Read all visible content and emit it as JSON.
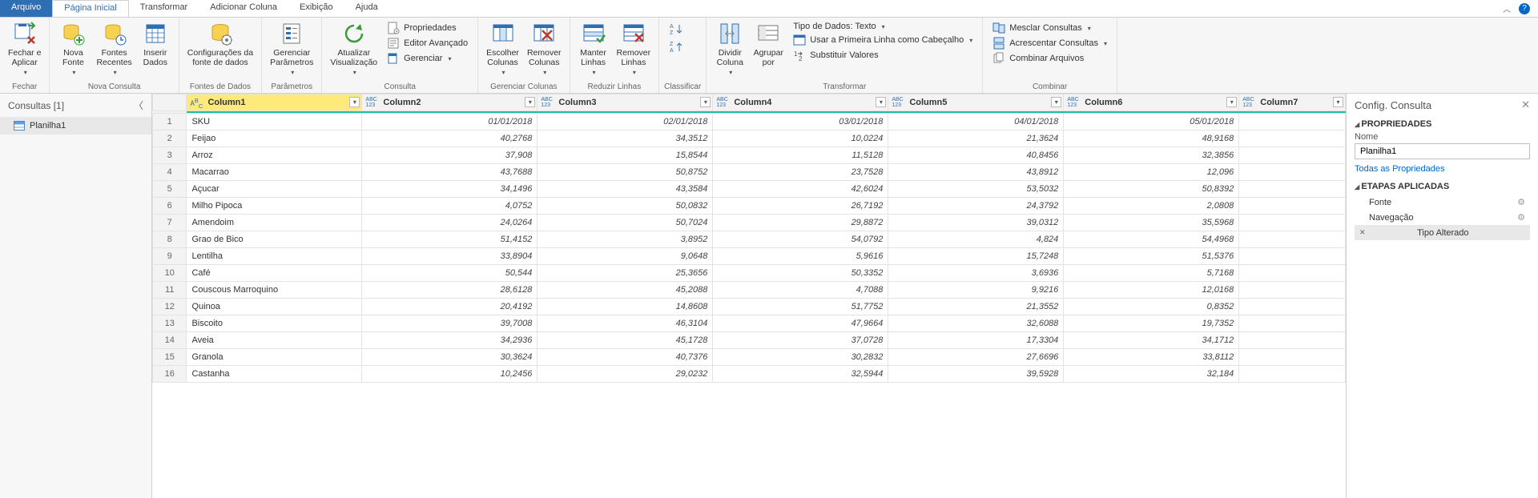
{
  "menubar": {
    "file": "Arquivo",
    "tabs": [
      "Página Inicial",
      "Transformar",
      "Adicionar Coluna",
      "Exibição",
      "Ajuda"
    ],
    "active_index": 0
  },
  "ribbon": {
    "groups": [
      {
        "label": "Fechar",
        "buttons": [
          {
            "name": "close-apply",
            "text": "Fechar e\nAplicar",
            "caret": true,
            "icon": "close-apply"
          }
        ]
      },
      {
        "label": "Nova Consulta",
        "buttons": [
          {
            "name": "new-source",
            "text": "Nova\nFonte",
            "caret": true,
            "icon": "new-source"
          },
          {
            "name": "recent-sources",
            "text": "Fontes\nRecentes",
            "caret": true,
            "icon": "recent-sources"
          },
          {
            "name": "enter-data",
            "text": "Inserir\nDados",
            "caret": false,
            "icon": "enter-data"
          }
        ]
      },
      {
        "label": "Fontes de Dados",
        "buttons": [
          {
            "name": "data-source-settings",
            "text": "Configurações da\nfonte de dados",
            "caret": false,
            "icon": "data-source-settings"
          }
        ]
      },
      {
        "label": "Parâmetros",
        "buttons": [
          {
            "name": "manage-parameters",
            "text": "Gerenciar\nParâmetros",
            "caret": true,
            "icon": "parameters"
          }
        ]
      },
      {
        "label": "Consulta",
        "buttons": [
          {
            "name": "refresh-preview",
            "text": "Atualizar\nVisualização",
            "caret": true,
            "icon": "refresh"
          }
        ],
        "stack": [
          {
            "name": "properties",
            "text": "Propriedades",
            "icon": "properties"
          },
          {
            "name": "advanced-editor",
            "text": "Editor Avançado",
            "icon": "advanced-editor"
          },
          {
            "name": "manage",
            "text": "Gerenciar",
            "icon": "manage",
            "caret": true
          }
        ]
      },
      {
        "label": "Gerenciar Colunas",
        "buttons": [
          {
            "name": "choose-columns",
            "text": "Escolher\nColunas",
            "caret": true,
            "icon": "choose-columns"
          },
          {
            "name": "remove-columns",
            "text": "Remover\nColunas",
            "caret": true,
            "icon": "remove-columns"
          }
        ]
      },
      {
        "label": "Reduzir Linhas",
        "buttons": [
          {
            "name": "keep-rows",
            "text": "Manter\nLinhas",
            "caret": true,
            "icon": "keep-rows"
          },
          {
            "name": "remove-rows",
            "text": "Remover\nLinhas",
            "caret": true,
            "icon": "remove-rows"
          }
        ]
      },
      {
        "label": "Classificar",
        "buttons": [],
        "ministack": [
          {
            "name": "sort-asc",
            "icon": "sort-asc"
          },
          {
            "name": "sort-desc",
            "icon": "sort-desc"
          }
        ]
      },
      {
        "label": "Transformar",
        "buttons": [
          {
            "name": "split-column",
            "text": "Dividir\nColuna",
            "caret": true,
            "icon": "split-column"
          },
          {
            "name": "group-by",
            "text": "Agrupar\npor",
            "caret": false,
            "icon": "group-by"
          }
        ],
        "stack": [
          {
            "name": "data-type",
            "text": "Tipo de Dados: Texto",
            "caret": true,
            "noicon": true
          },
          {
            "name": "first-row-headers",
            "text": "Usar a Primeira Linha como Cabeçalho",
            "caret": true,
            "icon": "headers"
          },
          {
            "name": "replace-values",
            "text": "Substituir Valores",
            "icon": "replace"
          }
        ]
      },
      {
        "label": "Combinar",
        "buttons": [],
        "stack": [
          {
            "name": "merge-queries",
            "text": "Mesclar Consultas",
            "caret": true,
            "icon": "merge"
          },
          {
            "name": "append-queries",
            "text": "Acrescentar Consultas",
            "caret": true,
            "icon": "append"
          },
          {
            "name": "combine-files",
            "text": "Combinar Arquivos",
            "icon": "combine-files"
          }
        ]
      }
    ]
  },
  "queries_panel": {
    "title": "Consultas [1]",
    "items": [
      {
        "name": "Planilha1"
      }
    ]
  },
  "grid": {
    "columns": [
      {
        "name": "Column1",
        "type": "ABC",
        "selected": true
      },
      {
        "name": "Column2",
        "type": "ABC123"
      },
      {
        "name": "Column3",
        "type": "ABC123"
      },
      {
        "name": "Column4",
        "type": "ABC123"
      },
      {
        "name": "Column5",
        "type": "ABC123"
      },
      {
        "name": "Column6",
        "type": "ABC123"
      },
      {
        "name": "Column7",
        "type": "ABC123"
      }
    ],
    "rows": [
      [
        "SKU",
        "01/01/2018",
        "02/01/2018",
        "03/01/2018",
        "04/01/2018",
        "05/01/2018",
        ""
      ],
      [
        "Feijao",
        "40,2768",
        "34,3512",
        "10,0224",
        "21,3624",
        "48,9168",
        ""
      ],
      [
        "Arroz",
        "37,908",
        "15,8544",
        "11,5128",
        "40,8456",
        "32,3856",
        ""
      ],
      [
        "Macarrao",
        "43,7688",
        "50,8752",
        "23,7528",
        "43,8912",
        "12,096",
        ""
      ],
      [
        "Açucar",
        "34,1496",
        "43,3584",
        "42,6024",
        "53,5032",
        "50,8392",
        ""
      ],
      [
        "Milho Pipoca",
        "4,0752",
        "50,0832",
        "26,7192",
        "24,3792",
        "2,0808",
        ""
      ],
      [
        "Amendoim",
        "24,0264",
        "50,7024",
        "29,8872",
        "39,0312",
        "35,5968",
        ""
      ],
      [
        "Grao de Bico",
        "51,4152",
        "3,8952",
        "54,0792",
        "4,824",
        "54,4968",
        ""
      ],
      [
        "Lentilha",
        "33,8904",
        "9,0648",
        "5,9616",
        "15,7248",
        "51,5376",
        ""
      ],
      [
        "Café",
        "50,544",
        "25,3656",
        "50,3352",
        "3,6936",
        "5,7168",
        ""
      ],
      [
        "Couscous Marroquino",
        "28,6128",
        "45,2088",
        "4,7088",
        "9,9216",
        "12,0168",
        ""
      ],
      [
        "Quinoa",
        "20,4192",
        "14,8608",
        "51,7752",
        "21,3552",
        "0,8352",
        ""
      ],
      [
        "Biscoito",
        "39,7008",
        "46,3104",
        "47,9664",
        "32,6088",
        "19,7352",
        ""
      ],
      [
        "Aveia",
        "34,2936",
        "45,1728",
        "37,0728",
        "17,3304",
        "34,1712",
        ""
      ],
      [
        "Granola",
        "30,3624",
        "40,7376",
        "30,2832",
        "27,6696",
        "33,8112",
        ""
      ],
      [
        "Castanha",
        "10,2456",
        "29,0232",
        "32,5944",
        "39,5928",
        "32,184",
        ""
      ]
    ]
  },
  "settings": {
    "title": "Config. Consulta",
    "properties_label": "PROPRIEDADES",
    "name_label": "Nome",
    "name_value": "Planilha1",
    "all_properties": "Todas as Propriedades",
    "applied_steps_label": "ETAPAS APLICADAS",
    "steps": [
      {
        "name": "Fonte",
        "gear": true
      },
      {
        "name": "Navegação",
        "gear": true
      },
      {
        "name": "Tipo Alterado",
        "active": true
      }
    ]
  },
  "icons": {
    "chevron_up": "⌃",
    "help": "?"
  }
}
